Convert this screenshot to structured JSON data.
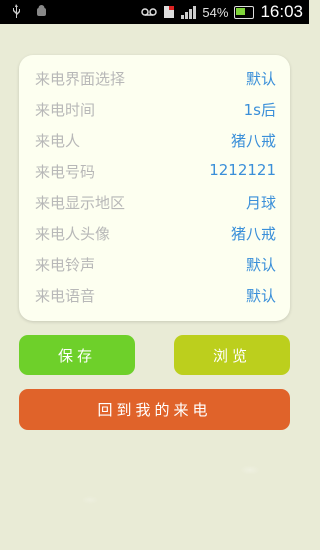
{
  "status_bar": {
    "battery_percent": "54%",
    "time": "16:03",
    "icons": [
      "usb-icon",
      "android-debug-icon",
      "voicemail-icon",
      "no-sim-icon",
      "signal-icon",
      "battery-icon"
    ]
  },
  "settings": [
    {
      "label": "来电界面选择",
      "value": "默认"
    },
    {
      "label": "来电时间",
      "value": "1s后"
    },
    {
      "label": "来电人",
      "value": "猪八戒"
    },
    {
      "label": "来电号码",
      "value": "1212121"
    },
    {
      "label": "来电显示地区",
      "value": "月球"
    },
    {
      "label": "来电人头像",
      "value": "猪八戒"
    },
    {
      "label": "来电铃声",
      "value": "默认"
    },
    {
      "label": "来电语音",
      "value": "默认"
    }
  ],
  "buttons": {
    "save": "保存",
    "browse": "浏览",
    "back": "回到我的来电"
  },
  "colors": {
    "background": "#e9ebd6",
    "card": "#fdfff0",
    "label": "#b8b8b8",
    "value": "#3a8fd9",
    "save": "#6ed02a",
    "browse": "#bccf1d",
    "back": "#e0632a"
  }
}
